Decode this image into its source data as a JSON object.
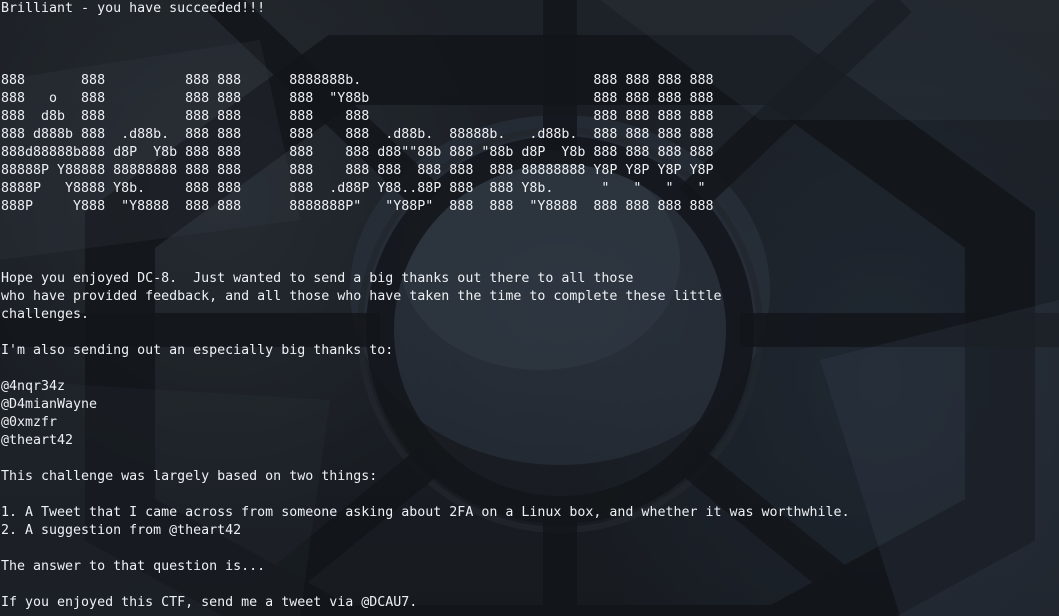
{
  "terminal": {
    "lines": [
      "Brilliant - you have succeeded!!!",
      "",
      "",
      "",
      "888       888          888 888      8888888b.                             888 888 888 888",
      "888   o   888          888 888      888  \"Y88b                            888 888 888 888",
      "888  d8b  888          888 888      888    888                            888 888 888 888",
      "888 d888b 888  .d88b.  888 888      888    888  .d88b.  88888b.   .d88b.  888 888 888 888",
      "888d88888b888 d8P  Y8b 888 888      888    888 d88\"\"88b 888 \"88b d8P  Y8b 888 888 888 888",
      "88888P Y88888 88888888 888 888      888    888 888  888 888  888 88888888 Y8P Y8P Y8P Y8P",
      "8888P   Y8888 Y8b.     888 888      888  .d88P Y88..88P 888  888 Y8b.      \"   \"   \"   \"",
      "888P     Y888  \"Y8888  888 888      8888888P\"   \"Y88P\"  888  888  \"Y8888  888 888 888 888",
      "",
      "",
      "",
      "Hope you enjoyed DC-8.  Just wanted to send a big thanks out there to all those",
      "who have provided feedback, and all those who have taken the time to complete these little",
      "challenges.",
      "",
      "I'm also sending out an especially big thanks to:",
      "",
      "@4nqr34z",
      "@D4mianWayne",
      "@0xmzfr",
      "@theart42",
      "",
      "This challenge was largely based on two things:",
      "",
      "1. A Tweet that I came across from someone asking about 2FA on a Linux box, and whether it was worthwhile.",
      "2. A suggestion from @theart42",
      "",
      "The answer to that question is...",
      "",
      "If you enjoyed this CTF, send me a tweet via @DCAU7."
    ]
  }
}
